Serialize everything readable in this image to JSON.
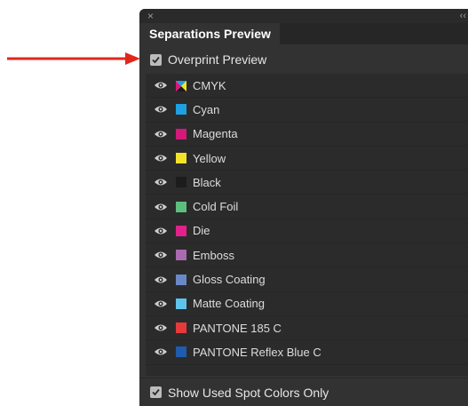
{
  "panel": {
    "close_glyph": "×",
    "collapse_glyph": "‹‹",
    "tab_label": "Separations Preview"
  },
  "overprint": {
    "label": "Overprint Preview",
    "checked": true
  },
  "show_used": {
    "label": "Show Used Spot Colors Only",
    "checked": true
  },
  "colors": [
    {
      "name": "CMYK",
      "swatch": "cmyk"
    },
    {
      "name": "Cyan",
      "swatch": "#1fa0e0"
    },
    {
      "name": "Magenta",
      "swatch": "#d4197a"
    },
    {
      "name": "Yellow",
      "swatch": "#f2e32a"
    },
    {
      "name": "Black",
      "swatch": "#1c1c1c"
    },
    {
      "name": "Cold Foil",
      "swatch": "#5cbf7e"
    },
    {
      "name": "Die",
      "swatch": "#e3218b"
    },
    {
      "name": "Emboss",
      "swatch": "#a86bb0"
    },
    {
      "name": "Gloss Coating",
      "swatch": "#6a88c8"
    },
    {
      "name": "Matte Coating",
      "swatch": "#5fc4ec"
    },
    {
      "name": "PANTONE 185 C",
      "swatch": "#e63a3a"
    },
    {
      "name": "PANTONE Reflex Blue C",
      "swatch": "#1f5cad"
    }
  ],
  "arrow_color": "#e1261c"
}
